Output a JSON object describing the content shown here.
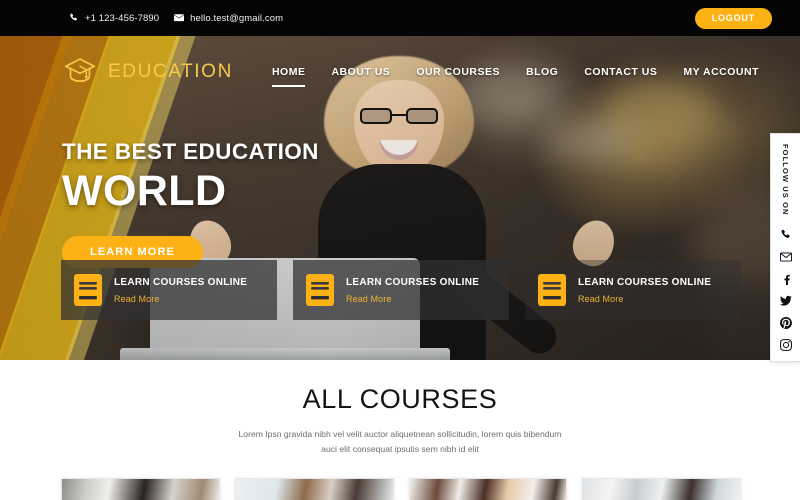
{
  "topbar": {
    "phone": "+1 123-456-7890",
    "email": "hello.test@gmail.com",
    "phone_icon": "phone-icon",
    "email_icon": "envelope-icon",
    "logout_label": "LOGOUT",
    "background": "#050505",
    "accent": "#fcb215"
  },
  "header": {
    "logo_text": "EDUCATION",
    "logo_icon": "graduation-cap-icon",
    "logo_color": "#fbc94a",
    "nav": [
      {
        "label": "HOME",
        "active": true
      },
      {
        "label": "ABOUT US",
        "active": false
      },
      {
        "label": "OUR COURSES",
        "active": false
      },
      {
        "label": "BLOG",
        "active": false
      },
      {
        "label": "CONTACT US",
        "active": false
      },
      {
        "label": "MY ACCOUNT",
        "active": false
      }
    ]
  },
  "hero": {
    "headline_top": "THE BEST EDUCATION",
    "headline_main": "WORLD",
    "cta_label": "LEARN MORE",
    "cta_color": "#fcb215",
    "stripe_orange": "#c26a08",
    "stripe_yellow": "#f4c21a",
    "cards": [
      {
        "title": "LEARN COURSES ONLINE",
        "link": "Read More",
        "icon": "book-icon"
      },
      {
        "title": "LEARN COURSES ONLINE",
        "link": "Read More",
        "icon": "book-icon"
      },
      {
        "title": "LEARN COURSES ONLINE",
        "link": "Read More",
        "icon": "book-icon"
      }
    ],
    "carousel": {
      "total": 3,
      "active_index": 0,
      "active_color": "#f0a81e"
    }
  },
  "social": {
    "label": "FOLLOW US ON",
    "items": [
      {
        "icon": "phone-icon"
      },
      {
        "icon": "envelope-icon"
      },
      {
        "icon": "facebook-icon"
      },
      {
        "icon": "twitter-icon"
      },
      {
        "icon": "pinterest-icon"
      },
      {
        "icon": "instagram-icon"
      }
    ]
  },
  "courses": {
    "title": "ALL COURSES",
    "subtitle": "Lorem Ipsn gravida nibh vel velit auctor aliquetnean sollicitudin, lorem quis bibendum auci elit consequat ipsutis sem nibh id elit",
    "cards": [
      {
        "index": 1
      },
      {
        "index": 2
      },
      {
        "index": 3
      },
      {
        "index": 4
      }
    ]
  }
}
